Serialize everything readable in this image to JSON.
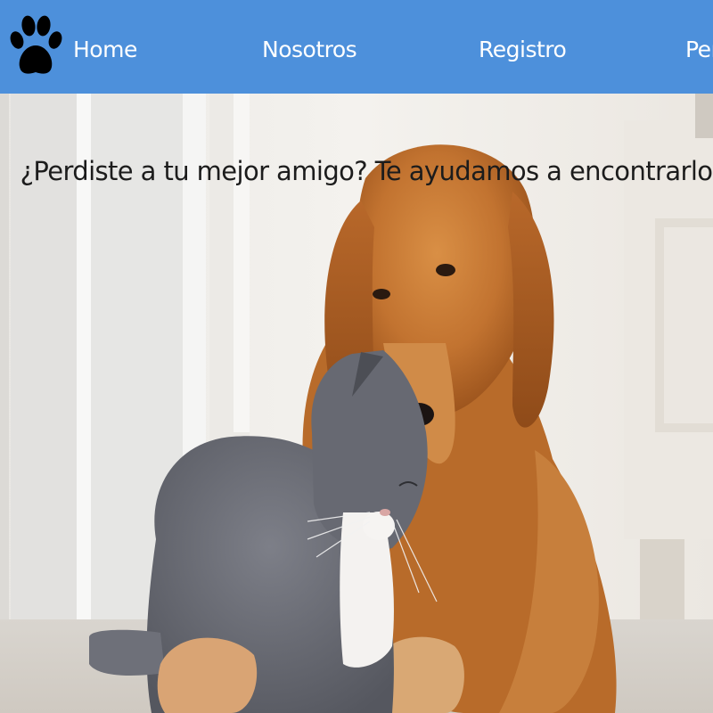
{
  "nav": {
    "logo_icon": "paw-icon",
    "items": [
      {
        "label": "Home"
      },
      {
        "label": "Nosotros"
      },
      {
        "label": "Registro"
      },
      {
        "label": "Per"
      }
    ]
  },
  "hero": {
    "title": "¿Perdiste a tu mejor amigo? Te ayudamos a encontrarlo",
    "image_icon": "dog-and-cat-photo"
  },
  "colors": {
    "nav_background": "#4d90db",
    "nav_text": "#ffffff",
    "hero_text": "#1c1c1c"
  }
}
